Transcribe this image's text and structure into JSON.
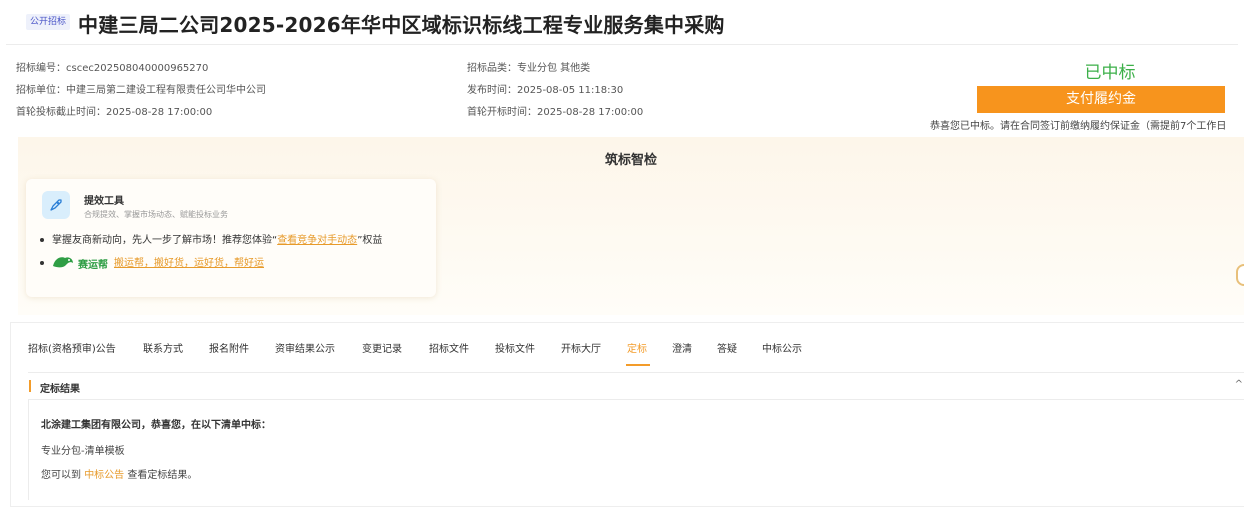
{
  "header": {
    "badge": "公开招标",
    "title": "中建三局二公司2025-2026年华中区域标识标线工程专业服务集中采购"
  },
  "info": {
    "col1": [
      "招标编号：cscec202508040000965270",
      "招标单位：中建三局第二建设工程有限责任公司华中公司",
      "首轮投标截止时间：2025-08-28 17:00:00"
    ],
    "col2": [
      "招标品类：专业分包 其他类",
      "发布时间：2025-08-05 11:18:30",
      "首轮开标时间：2025-08-28 17:00:00"
    ]
  },
  "status": {
    "won": "已中标",
    "pay_button": "支付履约金",
    "congrats": "恭喜您已中标。请在合同签订前缴纳履约保证金（需提前7个工作日"
  },
  "smart": {
    "title": "筑标智检",
    "tool_name": "提效工具",
    "tool_desc": "合规提效、掌握市场动态、赋能投标业务",
    "bullet1_prefix": "掌握友商新动向，先人一步了解市场！推荐您体验“",
    "bullet1_link": "查看竞争对手动态",
    "bullet1_suffix": "”权益",
    "brand_name": "赛运帮",
    "bullet2_link": "搬运帮，搬好货，运好货，帮好运"
  },
  "tabs": [
    "招标(资格预审)公告",
    "联系方式",
    "报名附件",
    "资审结果公示",
    "变更记录",
    "招标文件",
    "投标文件",
    "开标大厅",
    "定标",
    "澄清",
    "答疑",
    "中标公示"
  ],
  "active_tab": "定标",
  "result": {
    "title": "定标结果",
    "winner": "北涂建工集团有限公司，恭喜您，在以下清单中标：",
    "lot": "专业分包-清单模板",
    "see_prefix": "您可以到 ",
    "see_link": "中标公告",
    "see_suffix": " 查看定标结果。"
  },
  "colors": {
    "accent": "#f7941d",
    "success": "#3cb049",
    "link": "#e79a2a"
  }
}
